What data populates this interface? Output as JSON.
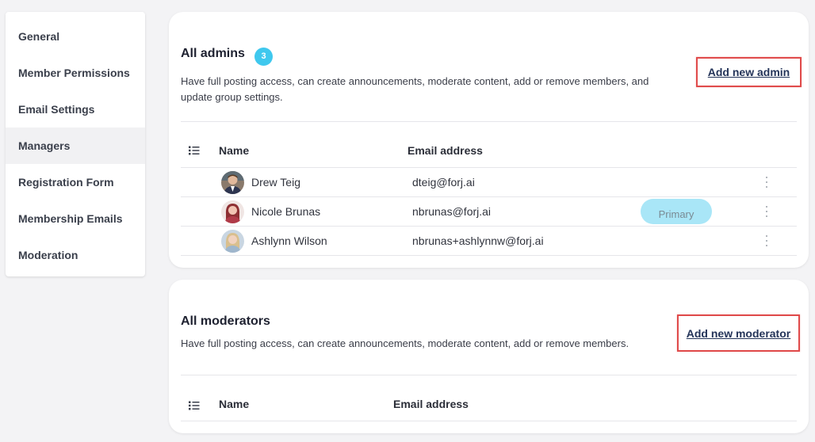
{
  "sidebar": {
    "items": [
      {
        "label": "General"
      },
      {
        "label": "Member Permissions"
      },
      {
        "label": "Email Settings"
      },
      {
        "label": "Managers"
      },
      {
        "label": "Registration Form"
      },
      {
        "label": "Membership Emails"
      },
      {
        "label": "Moderation"
      }
    ],
    "active": "Managers"
  },
  "admins": {
    "title": "All admins",
    "count": "3",
    "description": "Have full posting access, can create announcements, moderate content, add or remove members, and update group settings.",
    "add_label": "Add new admin",
    "columns": {
      "name": "Name",
      "email": "Email address"
    },
    "rows": [
      {
        "name": "Drew Teig",
        "email": "dteig@forj.ai",
        "badge": ""
      },
      {
        "name": "Nicole Brunas",
        "email": "nbrunas@forj.ai",
        "badge": "Primary"
      },
      {
        "name": "Ashlynn Wilson",
        "email": "nbrunas+ashlynnw@forj.ai",
        "badge": ""
      }
    ]
  },
  "moderators": {
    "title": "All moderators",
    "description": "Have full posting access, can create announcements, moderate content, add or remove members.",
    "add_label": "Add new moderator",
    "columns": {
      "name": "Name",
      "email": "Email address"
    }
  },
  "colors": {
    "accent_badge": "#3fc8ee",
    "primary_badge": "#a9e6f7",
    "highlight_border": "#e04b4b",
    "link": "#243459"
  },
  "icons": {
    "list": "list-icon",
    "more": "kebab-icon"
  }
}
